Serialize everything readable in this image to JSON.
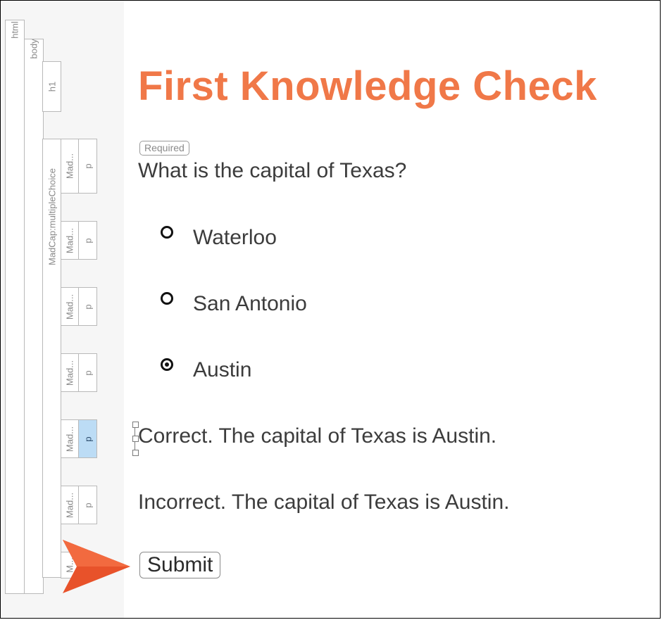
{
  "structure_bar": {
    "html": "html",
    "body": "body",
    "h1": "h1",
    "multiple_choice": "MadCap:multipleChoice",
    "madcap_short": "Mad...",
    "madcap_last": "M...",
    "p": "p"
  },
  "heading": "First Knowledge Check",
  "required_badge": "Required",
  "question": "What is the capital of Texas?",
  "choices": [
    {
      "label": "Waterloo",
      "selected": false
    },
    {
      "label": "San Antonio",
      "selected": false
    },
    {
      "label": "Austin",
      "selected": true
    }
  ],
  "feedback": {
    "correct": "Correct. The capital of Texas is Austin.",
    "incorrect": "Incorrect. The capital of Texas is Austin."
  },
  "submit_label": "Submit",
  "colors": {
    "heading": "#f07848",
    "arrow": "#e8522a",
    "selected_tag": "#bcdcf5"
  }
}
